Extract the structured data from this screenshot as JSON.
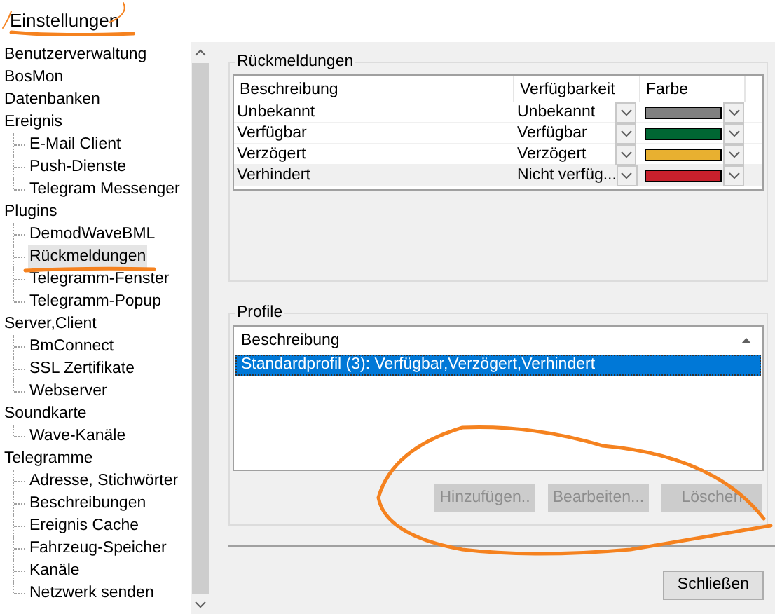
{
  "window": {
    "title": "Einstellungen"
  },
  "tree": [
    {
      "label": "Benutzerverwaltung",
      "selected": false
    },
    {
      "label": "BosMon",
      "selected": false
    },
    {
      "label": "Datenbanken",
      "selected": false
    },
    {
      "label": "Ereignis",
      "selected": false,
      "children": [
        {
          "label": "E-Mail Client",
          "selected": false
        },
        {
          "label": "Push-Dienste",
          "selected": false
        },
        {
          "label": "Telegram Messenger",
          "selected": false
        }
      ]
    },
    {
      "label": "Plugins",
      "selected": false,
      "children": [
        {
          "label": "DemodWaveBML",
          "selected": false
        },
        {
          "label": "Rückmeldungen",
          "selected": true
        },
        {
          "label": "Telegramm-Fenster",
          "selected": false
        },
        {
          "label": "Telegramm-Popup",
          "selected": false
        }
      ]
    },
    {
      "label": "Server,Client",
      "selected": false,
      "children": [
        {
          "label": "BmConnect",
          "selected": false
        },
        {
          "label": "SSL Zertifikate",
          "selected": false
        },
        {
          "label": "Webserver",
          "selected": false
        }
      ]
    },
    {
      "label": "Soundkarte",
      "selected": false,
      "children": [
        {
          "label": "Wave-Kanäle",
          "selected": false
        }
      ]
    },
    {
      "label": "Telegramme",
      "selected": false,
      "children": [
        {
          "label": "Adresse, Stichwörter",
          "selected": false
        },
        {
          "label": "Beschreibungen",
          "selected": false
        },
        {
          "label": "Ereignis Cache",
          "selected": false
        },
        {
          "label": "Fahrzeug-Speicher",
          "selected": false
        },
        {
          "label": "Kanäle",
          "selected": false
        },
        {
          "label": "Netzwerk senden",
          "selected": false
        }
      ]
    }
  ],
  "feedback": {
    "title": "Rückmeldungen",
    "columns": [
      "Beschreibung",
      "Verfügbarkeit",
      "Farbe"
    ],
    "rows": [
      {
        "description": "Unbekannt",
        "availability": "Unbekannt",
        "color": "#808080",
        "selected": false
      },
      {
        "description": "Verfügbar",
        "availability": "Verfügbar",
        "color": "#006633",
        "selected": false
      },
      {
        "description": "Verzögert",
        "availability": "Verzögert",
        "color": "#e8b030",
        "selected": false
      },
      {
        "description": "Verhindert",
        "availability": "Nicht verfüg...",
        "color": "#c8202c",
        "selected": true
      }
    ]
  },
  "profiles": {
    "title": "Profile",
    "column": "Beschreibung",
    "rows": [
      {
        "label": "Standardprofil (3): Verfügbar,Verzögert,Verhindert",
        "selected": true
      }
    ],
    "buttons": [
      {
        "label": "Hinzufügen..",
        "disabled": true
      },
      {
        "label": "Bearbeiten...",
        "disabled": true
      },
      {
        "label": "Löschen",
        "disabled": true
      }
    ]
  },
  "close_button": {
    "label": "Schließen",
    "disabled": false
  }
}
